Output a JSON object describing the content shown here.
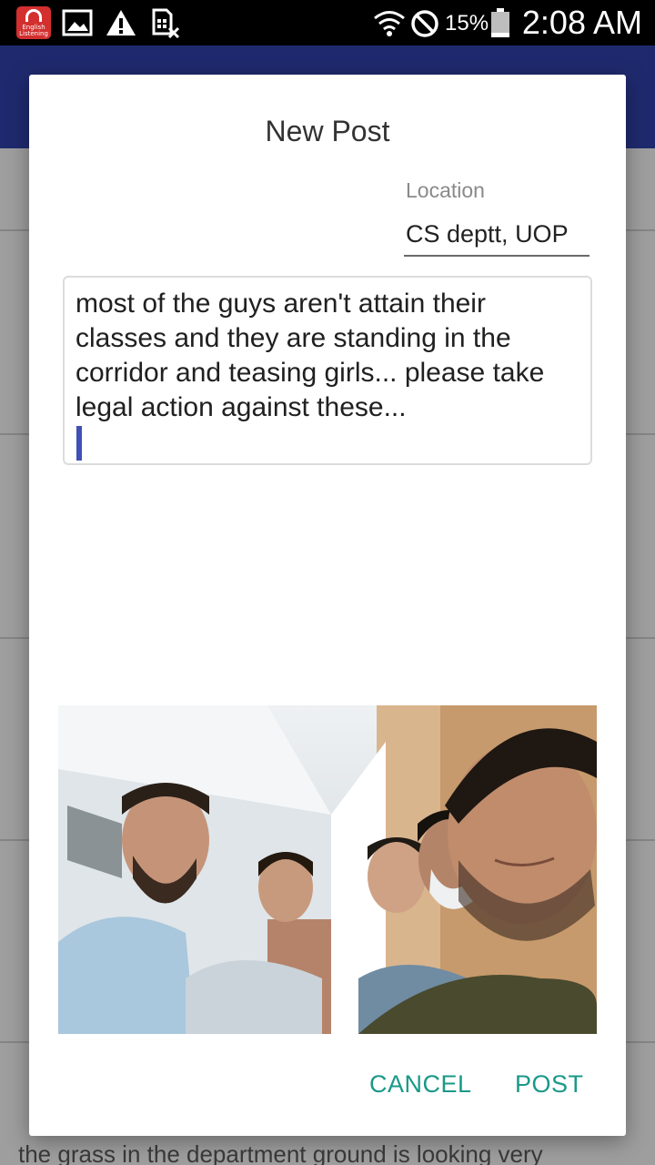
{
  "status_bar": {
    "app_icon_text": "English Listening",
    "battery_percent": "15%",
    "time": "2:08 AM",
    "icons": [
      "english-listening-app-icon",
      "gallery-icon",
      "warning-icon",
      "sim-off-icon",
      "wifi-icon",
      "do-not-disturb-icon",
      "battery-icon"
    ]
  },
  "background_list": {
    "bottom_text": "the grass in the department ground is looking very"
  },
  "dialog": {
    "title": "New Post",
    "location": {
      "label": "Location",
      "value": "CS deptt, UOP"
    },
    "post_text": "most of the guys  aren't attain their classes and they  are standing in the corridor and teasing  girls... please take legal action against these...",
    "actions": {
      "cancel": "CANCEL",
      "post": "POST"
    }
  },
  "colors": {
    "accent": "#1a9988",
    "primary": "#1f2a6e",
    "cursor": "#3f51b5"
  }
}
